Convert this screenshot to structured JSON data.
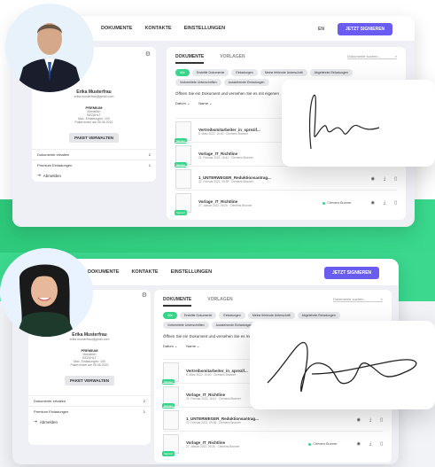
{
  "colors": {
    "accent": "#6a5cf0",
    "green": "#38d48a"
  },
  "header1": {
    "nav": [
      "DOKUMENTE",
      "KONTAKTE",
      "EINSTELLUNGEN"
    ],
    "lang": "EN",
    "sign": "JETZT SIGNIEREN"
  },
  "profile1": {
    "name": "Erika Musterfrau",
    "email": "erika.musterfrau@gmail.com",
    "plan_title": "PREMIUM",
    "plan_line1": "Monatlich",
    "plan_line2": "BEZAHLT",
    "plan_line3": "Max. Einladungen: 100",
    "plan_line4": "Paket endet am 05.06.2022",
    "btn": "PAKET VERWALTEN",
    "rows": [
      {
        "label": "Dokumente erhalten",
        "count": "2"
      },
      {
        "label": "Premium Einladungen",
        "count": "1"
      }
    ],
    "logout": "Abmelden"
  },
  "main1": {
    "tab_active": "DOKUMENTE",
    "tab_inactive": "VORLAGEN",
    "search": "Dokumente suchen...",
    "chips": [
      "Alle",
      "Erstellte Dokumente",
      "Einladungen",
      "Meine fehlende Unterschrift",
      "Abgelehnte Einladungen",
      "Vorbereitete Unterschriften",
      "Ausstehende Einladungen"
    ],
    "hint": "Öffnen Sie ein Dokument und versehen Sie es mit eigenen",
    "sort": [
      "Datum",
      "Name"
    ],
    "docs": [
      {
        "title": "Vertreibsmitarbeiter_in_sprezif...",
        "sub": "5. März 2022, 10:40 · Clemens Brunner",
        "badge": "Signiert",
        "status": ""
      },
      {
        "title": "Vorlage_IT_Richtline",
        "sub": "21. Februar 2022, 16:41 · Clemens Brunner",
        "badge": "Signiert",
        "status": ""
      },
      {
        "title": "1_UNTERWEGER_Reduktionsantrag...",
        "sub": "22. Februar 2022, 09:35 · Clemens Brunner",
        "badge": "",
        "status": ""
      },
      {
        "title": "Vorlage_IT_Richtline",
        "sub": "27. Januar 2022, 09:25 · Clemens Brunner",
        "badge": "Signiert",
        "status": "Clemens Brunner"
      }
    ]
  },
  "header2": {
    "nav": [
      "DOKUMENTE",
      "KONTAKTE",
      "EINSTELLUNGEN"
    ],
    "sign": "JETZT SIGNIEREN"
  },
  "profile2": {
    "name": "Erika Musterfrau",
    "email": "erika.musterfrau@gmail.com",
    "plan_title": "PREMIUM",
    "plan_line1": "Monatlich",
    "plan_line2": "BEZAHLT",
    "plan_line3": "Max. Einladungen: 100",
    "plan_line4": "Paket endet am 05.06.2022",
    "btn": "PAKET VERWALTEN",
    "rows": [
      {
        "label": "Dokumente erhalten",
        "count": "2"
      },
      {
        "label": "Premium Einladungen",
        "count": "1"
      }
    ],
    "logout": "Abmelden"
  },
  "main2": {
    "tab_active": "DOKUMENTE",
    "tab_inactive": "VORLAGEN",
    "search": "Dokumente suchen...",
    "chips": [
      "Alle",
      "Erstellte Dokumente",
      "Einladungen",
      "Meine fehlende Unterschrift",
      "Abgelehnte Einladungen",
      "Vorbereitete Unterschriften",
      "Ausstehende Einladungen"
    ],
    "hint": "Öffnen Sie ein Dokument und versehen Sie es mit eigenen",
    "sort": [
      "Datum",
      "Name"
    ],
    "docs": [
      {
        "title": "Vertreibsmitarbeiter_in_sprezif...",
        "sub": "5. März 2022, 10:40 · Clemens Brunner",
        "badge": "Signiert",
        "status": ""
      },
      {
        "title": "Vorlage_IT_Richtline",
        "sub": "21. Februar 2022, 16:41 · Clemens Brunner",
        "badge": "Signiert",
        "status": ""
      },
      {
        "title": "1_UNTERWEGER_Reduktionsantrag...",
        "sub": "22. Februar 2022, 09:35 · Clemens Brunner",
        "badge": "",
        "status": ""
      },
      {
        "title": "Vorlage_IT_Richtline",
        "sub": "27. Januar 2022, 09:25 · Clemens Brunner",
        "badge": "Signiert",
        "status": "Clemens Brunner"
      }
    ]
  }
}
